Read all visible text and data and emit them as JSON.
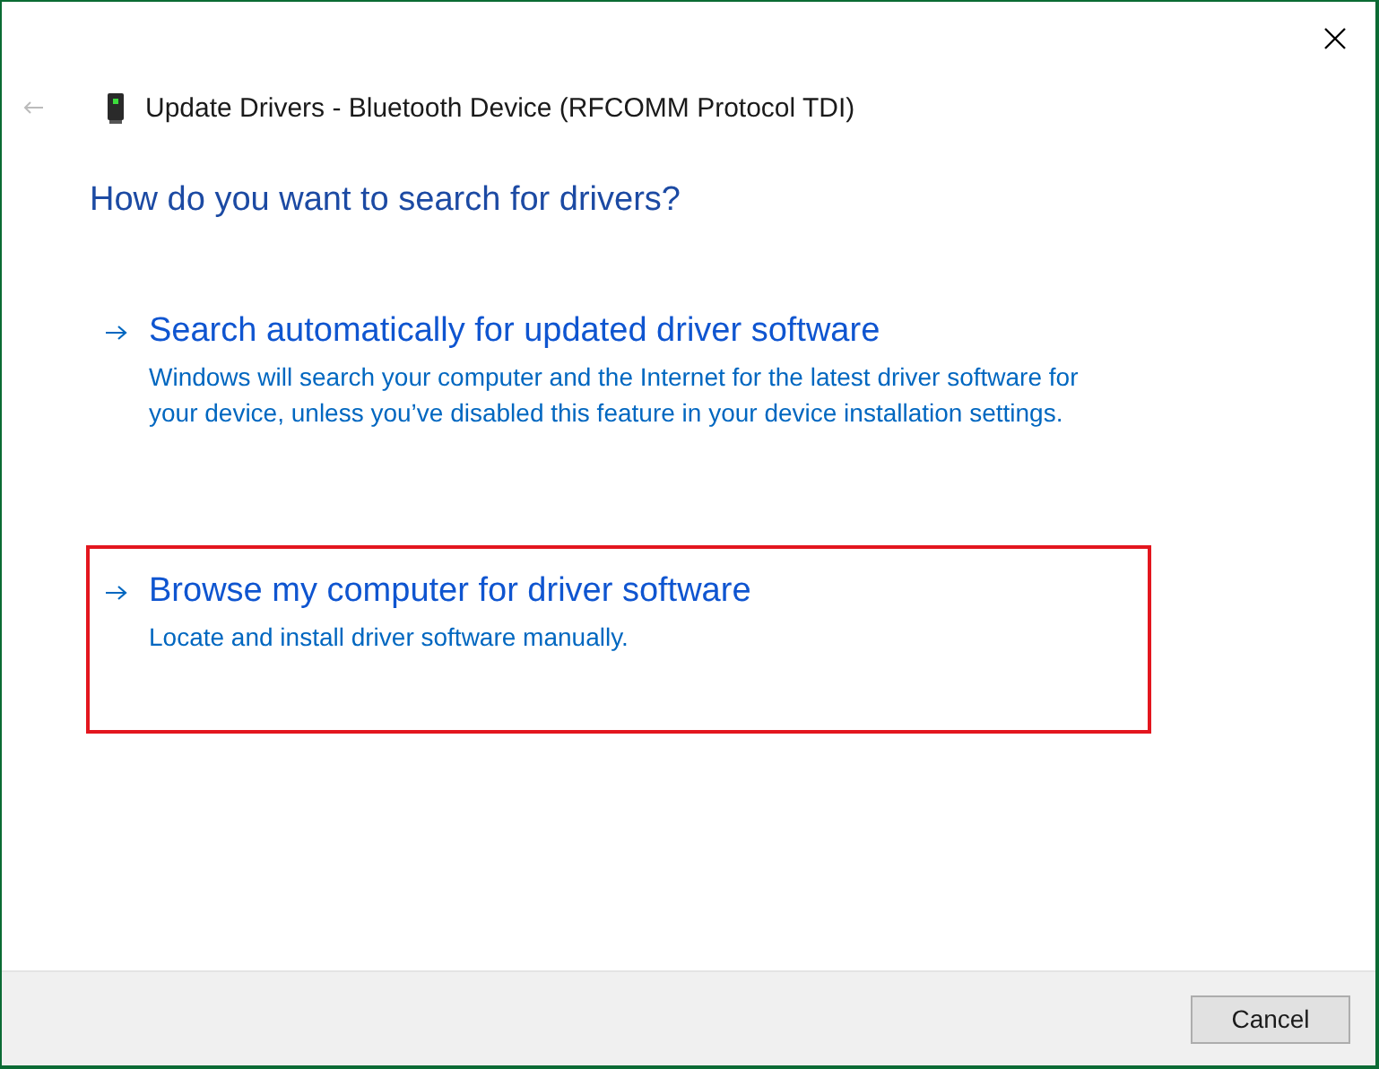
{
  "window": {
    "title": "Update Drivers - Bluetooth Device (RFCOMM Protocol TDI)"
  },
  "heading": "How do you want to search for drivers?",
  "options": [
    {
      "title": "Search automatically for updated driver software",
      "description": "Windows will search your computer and the Internet for the latest driver software for your device, unless you’ve disabled this feature in your device installation settings.",
      "highlighted": false
    },
    {
      "title": "Browse my computer for driver software",
      "description": "Locate and install driver software manually.",
      "highlighted": true
    }
  ],
  "buttons": [
    "Cancel"
  ]
}
